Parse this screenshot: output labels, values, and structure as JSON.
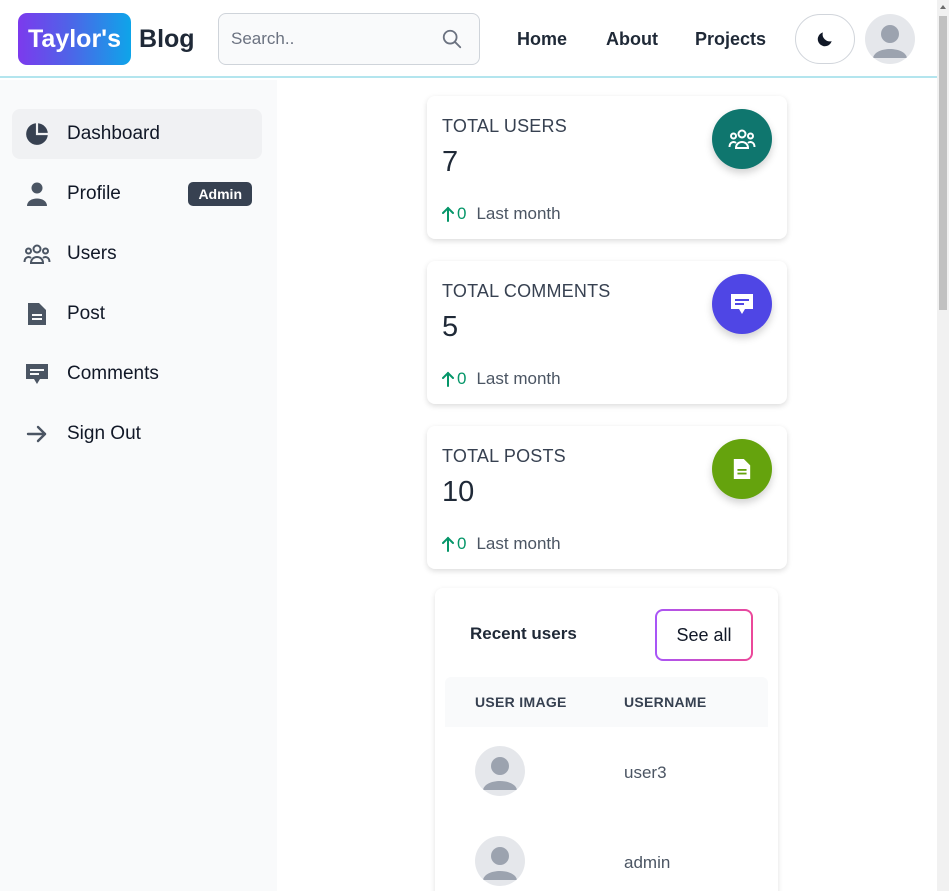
{
  "header": {
    "logo_badge": "Taylor's",
    "logo_text": "Blog",
    "search_placeholder": "Search..",
    "nav": [
      "Home",
      "About",
      "Projects"
    ]
  },
  "sidebar": {
    "items": [
      {
        "label": "Dashboard",
        "icon": "pie-chart-icon",
        "active": true
      },
      {
        "label": "Profile",
        "icon": "user-icon",
        "badge": "Admin"
      },
      {
        "label": "Users",
        "icon": "users-group-icon"
      },
      {
        "label": "Post",
        "icon": "document-icon"
      },
      {
        "label": "Comments",
        "icon": "comment-icon"
      },
      {
        "label": "Sign Out",
        "icon": "arrow-right-icon"
      }
    ]
  },
  "stats": [
    {
      "title": "TOTAL USERS",
      "value": "7",
      "trend": "0",
      "trend_label": "Last month",
      "icon": "users-group-icon",
      "color": "#0f766e"
    },
    {
      "title": "TOTAL COMMENTS",
      "value": "5",
      "trend": "0",
      "trend_label": "Last month",
      "icon": "comment-icon",
      "color": "#4f46e5"
    },
    {
      "title": "TOTAL POSTS",
      "value": "10",
      "trend": "0",
      "trend_label": "Last month",
      "icon": "document-icon",
      "color": "#65a30d"
    }
  ],
  "recent_users": {
    "title": "Recent users",
    "see_all": "See all",
    "columns": [
      "USER IMAGE",
      "USERNAME"
    ],
    "rows": [
      {
        "username": "user3"
      },
      {
        "username": "admin"
      }
    ]
  },
  "colors": {
    "header_border": "#b3e5ee",
    "trend_up": "#059669"
  }
}
